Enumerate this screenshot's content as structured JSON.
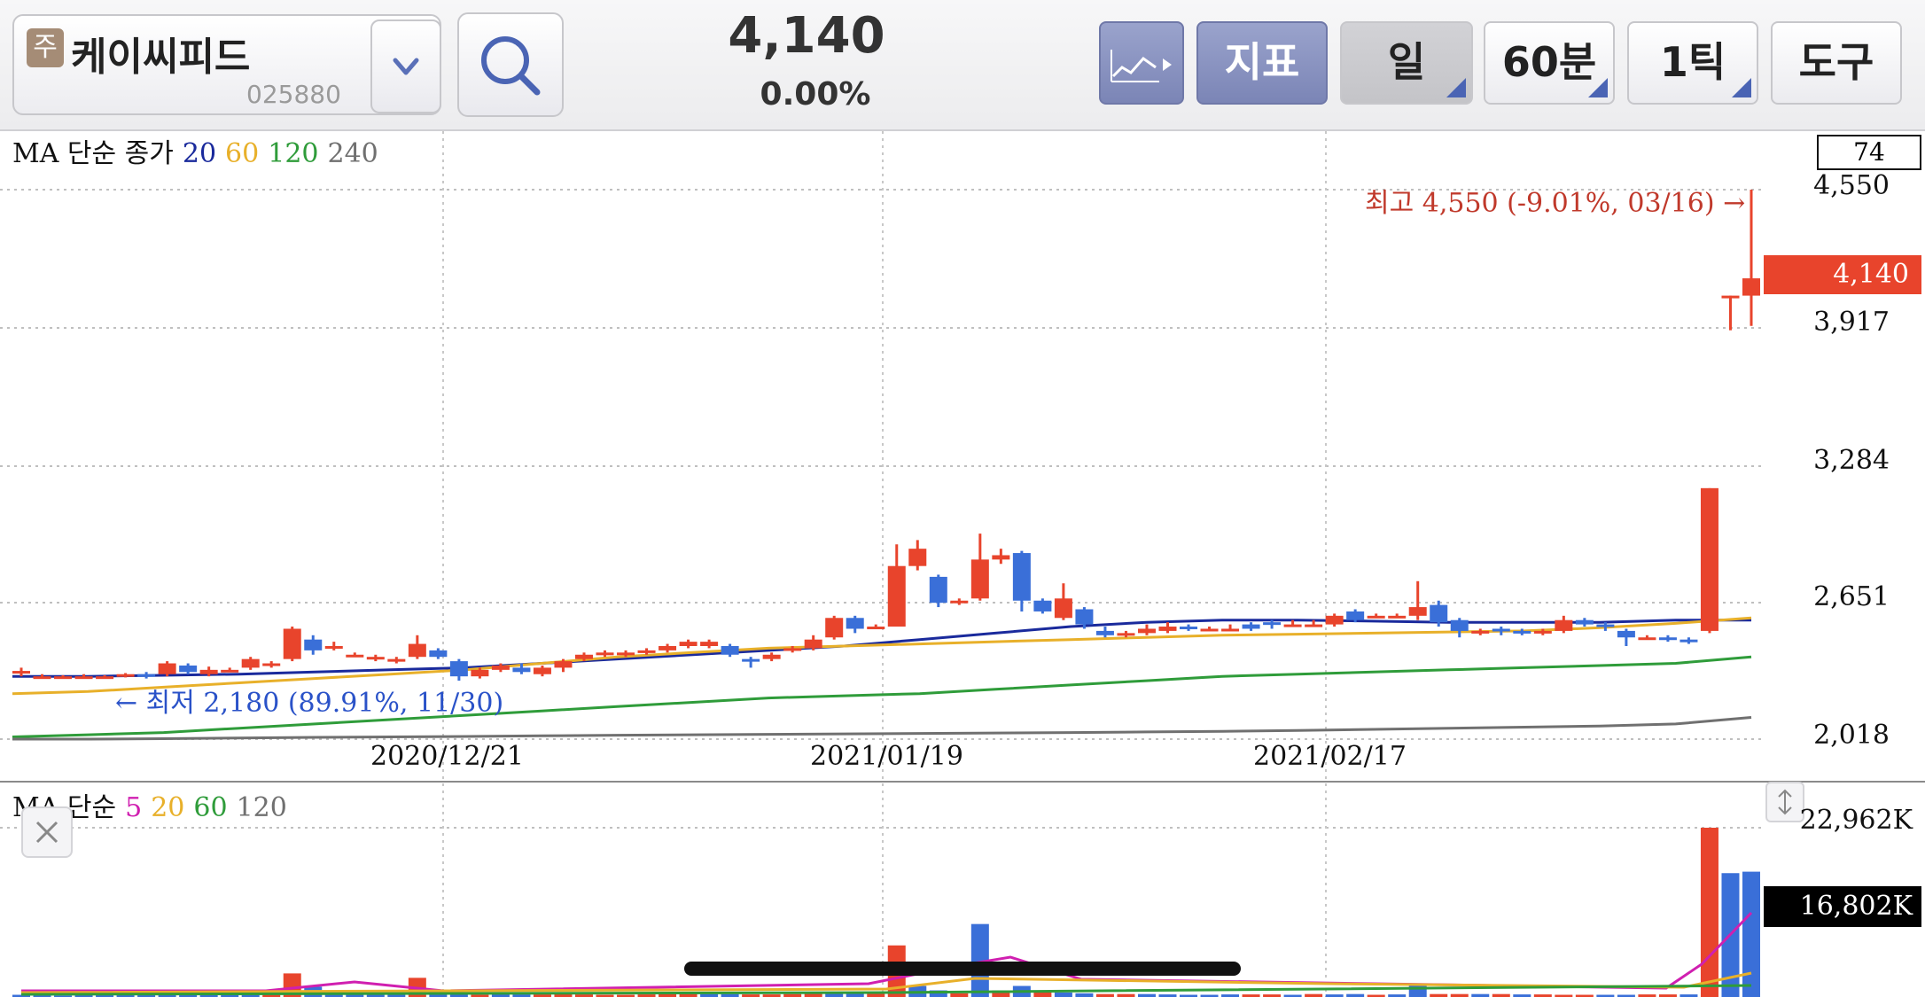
{
  "stock": {
    "tag": "주",
    "name": "케이씨피드",
    "code": "025880",
    "price": "4,140",
    "change": "0.00%"
  },
  "toolbar": {
    "chart_type": "chart-type",
    "indicator": "지표",
    "period": "일",
    "minute": "60분",
    "tick": "1틱",
    "tools": "도구"
  },
  "price_chart": {
    "ma_title": "MA 단순 종가",
    "ma_periods": [
      "20",
      "60",
      "120",
      "240"
    ],
    "page_count": "74",
    "y_ticks": [
      "4,550",
      "3,917",
      "3,284",
      "2,651",
      "2,018"
    ],
    "current_price_label": "4,140",
    "high_note": "최고 4,550 (-9.01%, 03/16) →",
    "low_note": "← 최저 2,180 (89.91%, 11/30)",
    "dates": [
      "2020/12/21",
      "2021/01/19",
      "2021/02/17"
    ]
  },
  "volume_chart": {
    "ma_title": "MA 단순",
    "ma_periods": [
      "5",
      "20",
      "60",
      "120"
    ],
    "y_max": "22,962K",
    "current_volume": "16,802K"
  },
  "colors": {
    "up": "#e8442c",
    "down": "#3a6fd8",
    "ma20": "#1a2a9c",
    "ma60": "#e8b02a",
    "ma120": "#2f9c3a",
    "ma240": "#707070",
    "vol_ma5": "#d01fb0"
  },
  "chart_data": [
    {
      "type": "candlestick",
      "title": "MA 단순 종가",
      "y_range": [
        2018,
        4550
      ],
      "x_labels": [
        "2020/12/21",
        "2021/01/19",
        "2021/02/17"
      ],
      "candles": [
        [
          2320,
          2325,
          2300,
          2340
        ],
        [
          2300,
          2300,
          2290,
          2310
        ],
        [
          2300,
          2300,
          2295,
          2305
        ],
        [
          2300,
          2300,
          2295,
          2310
        ],
        [
          2300,
          2300,
          2295,
          2305
        ],
        [
          2300,
          2310,
          2295,
          2315
        ],
        [
          2310,
          2300,
          2290,
          2320
        ],
        [
          2310,
          2360,
          2300,
          2370
        ],
        [
          2350,
          2320,
          2310,
          2360
        ],
        [
          2310,
          2330,
          2300,
          2345
        ],
        [
          2330,
          2330,
          2320,
          2340
        ],
        [
          2340,
          2380,
          2330,
          2390
        ],
        [
          2350,
          2360,
          2340,
          2370
        ],
        [
          2380,
          2520,
          2370,
          2530
        ],
        [
          2470,
          2420,
          2400,
          2490
        ],
        [
          2440,
          2440,
          2420,
          2460
        ],
        [
          2400,
          2400,
          2390,
          2410
        ],
        [
          2380,
          2390,
          2370,
          2400
        ],
        [
          2370,
          2380,
          2360,
          2390
        ],
        [
          2390,
          2450,
          2380,
          2490
        ],
        [
          2420,
          2390,
          2380,
          2430
        ],
        [
          2370,
          2300,
          2280,
          2380
        ],
        [
          2300,
          2330,
          2290,
          2340
        ],
        [
          2330,
          2350,
          2320,
          2360
        ],
        [
          2340,
          2320,
          2310,
          2360
        ],
        [
          2310,
          2340,
          2300,
          2350
        ],
        [
          2340,
          2370,
          2320,
          2380
        ],
        [
          2380,
          2400,
          2370,
          2410
        ],
        [
          2400,
          2410,
          2390,
          2420
        ],
        [
          2400,
          2410,
          2390,
          2420
        ],
        [
          2410,
          2420,
          2400,
          2430
        ],
        [
          2420,
          2440,
          2410,
          2450
        ],
        [
          2440,
          2460,
          2430,
          2470
        ],
        [
          2440,
          2460,
          2430,
          2470
        ],
        [
          2440,
          2400,
          2390,
          2450
        ],
        [
          2380,
          2370,
          2340,
          2390
        ],
        [
          2380,
          2400,
          2370,
          2410
        ],
        [
          2420,
          2430,
          2410,
          2440
        ],
        [
          2430,
          2470,
          2420,
          2490
        ],
        [
          2480,
          2570,
          2470,
          2580
        ],
        [
          2570,
          2520,
          2500,
          2580
        ],
        [
          2530,
          2530,
          2520,
          2540
        ],
        [
          2530,
          2810,
          2530,
          2910
        ],
        [
          2810,
          2890,
          2790,
          2930
        ],
        [
          2760,
          2640,
          2620,
          2770
        ],
        [
          2640,
          2650,
          2630,
          2660
        ],
        [
          2660,
          2840,
          2650,
          2960
        ],
        [
          2840,
          2860,
          2820,
          2890
        ],
        [
          2870,
          2650,
          2600,
          2880
        ],
        [
          2650,
          2600,
          2590,
          2660
        ],
        [
          2570,
          2660,
          2560,
          2730
        ],
        [
          2610,
          2540,
          2520,
          2620
        ],
        [
          2510,
          2490,
          2480,
          2530
        ],
        [
          2490,
          2500,
          2480,
          2510
        ],
        [
          2500,
          2520,
          2490,
          2540
        ],
        [
          2510,
          2530,
          2500,
          2550
        ],
        [
          2530,
          2520,
          2510,
          2540
        ],
        [
          2520,
          2520,
          2510,
          2530
        ],
        [
          2520,
          2520,
          2510,
          2540
        ],
        [
          2540,
          2520,
          2510,
          2550
        ],
        [
          2550,
          2540,
          2520,
          2560
        ],
        [
          2540,
          2540,
          2530,
          2560
        ],
        [
          2540,
          2540,
          2530,
          2560
        ],
        [
          2540,
          2580,
          2530,
          2590
        ],
        [
          2600,
          2560,
          2550,
          2610
        ],
        [
          2580,
          2580,
          2570,
          2590
        ],
        [
          2580,
          2580,
          2570,
          2590
        ],
        [
          2580,
          2620,
          2560,
          2740
        ],
        [
          2630,
          2550,
          2530,
          2650
        ],
        [
          2560,
          2510,
          2480,
          2570
        ],
        [
          2500,
          2510,
          2490,
          2520
        ],
        [
          2520,
          2510,
          2490,
          2530
        ],
        [
          2510,
          2500,
          2490,
          2520
        ],
        [
          2500,
          2510,
          2490,
          2520
        ],
        [
          2510,
          2560,
          2500,
          2580
        ],
        [
          2560,
          2540,
          2530,
          2570
        ],
        [
          2540,
          2530,
          2510,
          2550
        ],
        [
          2510,
          2480,
          2440,
          2520
        ],
        [
          2480,
          2480,
          2470,
          2490
        ],
        [
          2480,
          2470,
          2460,
          2490
        ],
        [
          2470,
          2460,
          2450,
          2480
        ],
        [
          2510,
          3170,
          2500,
          3170
        ],
        [
          4060,
          4060,
          3900,
          4060
        ],
        [
          4060,
          4140,
          3920,
          4550
        ]
      ],
      "series": [
        {
          "name": "20",
          "values": [
            2300,
            2300,
            2305,
            2310,
            2320,
            2330,
            2340,
            2360,
            2380,
            2400,
            2420,
            2440,
            2470,
            2500,
            2530,
            2550,
            2560,
            2560,
            2555,
            2550,
            2550,
            2550,
            2560,
            2560
          ]
        },
        {
          "name": "60",
          "values": [
            2220,
            2230,
            2250,
            2270,
            2290,
            2310,
            2330,
            2360,
            2390,
            2410,
            2430,
            2440,
            2450,
            2460,
            2470,
            2480,
            2490,
            2495,
            2500,
            2505,
            2510,
            2525,
            2545,
            2570
          ]
        },
        {
          "name": "120",
          "values": [
            2020,
            2030,
            2040,
            2060,
            2080,
            2100,
            2120,
            2140,
            2160,
            2180,
            2200,
            2210,
            2220,
            2240,
            2260,
            2280,
            2300,
            2310,
            2320,
            2330,
            2340,
            2350,
            2360,
            2390
          ]
        },
        {
          "name": "240",
          "values": [
            2010,
            2010,
            2012,
            2015,
            2018,
            2020,
            2022,
            2025,
            2028,
            2030,
            2032,
            2034,
            2036,
            2038,
            2040,
            2043,
            2046,
            2050,
            2055,
            2060,
            2065,
            2070,
            2080,
            2110
          ]
        }
      ]
    },
    {
      "type": "bar",
      "title": "MA 단순",
      "y_max_label": "22,962K",
      "values": [
        300,
        250,
        200,
        300,
        250,
        250,
        300,
        250,
        250,
        300,
        300,
        350,
        400,
        3200,
        1400,
        500,
        500,
        400,
        350,
        2600,
        700,
        400,
        300,
        400,
        350,
        350,
        400,
        350,
        300,
        300,
        350,
        400,
        500,
        400,
        400,
        350,
        350,
        400,
        500,
        600,
        500,
        450,
        7000,
        1500,
        900,
        500,
        9900,
        900,
        1500,
        700,
        600,
        500,
        400,
        400,
        400,
        350,
        300,
        300,
        350,
        350,
        350,
        300,
        400,
        350,
        400,
        300,
        350,
        1800,
        400,
        400,
        400,
        400,
        350,
        350,
        300,
        300,
        300,
        300,
        350,
        350,
        350,
        22962,
        16802,
        17000
      ],
      "up": [
        0,
        0,
        0,
        0,
        0,
        0,
        0,
        0,
        0,
        0,
        0,
        0,
        1,
        1,
        0,
        0,
        0,
        0,
        0,
        1,
        0,
        0,
        1,
        0,
        0,
        1,
        1,
        1,
        1,
        1,
        1,
        1,
        1,
        0,
        0,
        1,
        1,
        1,
        1,
        0,
        0,
        1,
        1,
        0,
        0,
        1,
        0,
        1,
        0,
        1,
        0,
        0,
        1,
        1,
        0,
        0,
        0,
        0,
        0,
        1,
        1,
        0,
        1,
        0,
        0,
        1,
        0,
        0,
        1,
        1,
        0,
        1,
        0,
        1,
        1,
        1,
        0,
        0,
        1,
        1,
        0,
        1
      ]
    }
  ]
}
